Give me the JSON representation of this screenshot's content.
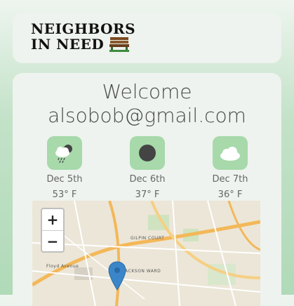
{
  "header": {
    "logo_line1": "Neighbors",
    "logo_line2": "in Need"
  },
  "welcome": {
    "greeting": "Welcome",
    "email": "alsobob@gmail.com"
  },
  "forecast": [
    {
      "icon": "rain-cloud-icon",
      "date": "Dec 5th",
      "temp": "53° F"
    },
    {
      "icon": "night-moon-icon",
      "date": "Dec 6th",
      "temp": "37° F"
    },
    {
      "icon": "cloud-icon",
      "date": "Dec 7th",
      "temp": "36° F"
    }
  ],
  "map": {
    "zoom_in": "+",
    "zoom_out": "−",
    "labels": {
      "gilpin": "GILPIN COURT",
      "jackson": "JACKSON WARD",
      "floyd": "Floyd Avenue"
    }
  },
  "colors": {
    "tile": "#a7d9aa",
    "marker": "#3b86c9"
  }
}
